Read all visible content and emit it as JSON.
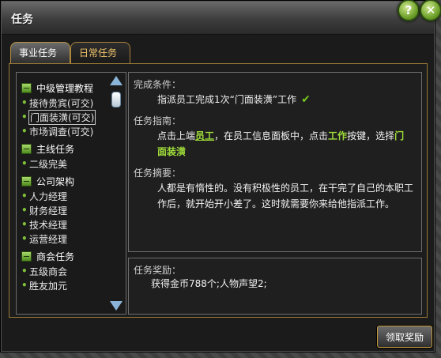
{
  "window": {
    "title": "任务",
    "help_label": "?",
    "close_label": "✕"
  },
  "tabs": [
    {
      "label": "事业任务",
      "active": true
    },
    {
      "label": "日常任务",
      "active": false
    }
  ],
  "task_list": {
    "groups": [
      {
        "label": "中级管理教程",
        "items": [
          "接待贵宾(可交)",
          "门面装潢(可交)",
          "市场调查(可交)"
        ]
      },
      {
        "label": "主线任务",
        "items": [
          "二级完美"
        ]
      },
      {
        "label": "公司架构",
        "items": [
          "人力经理",
          "财务经理",
          "技术经理",
          "运营经理"
        ]
      },
      {
        "label": "商会任务",
        "items": [
          "五级商会",
          "胜友加元"
        ]
      }
    ],
    "selected": "门面装潢(可交)"
  },
  "detail": {
    "condition_title": "完成条件：",
    "condition_text": "指派员工完成1次“门面装潢”工作",
    "guide_title": "任务指南：",
    "guide_text_1": "点击上端",
    "guide_kw_1": "员工",
    "guide_text_2": "，在员工信息面板中，点击",
    "guide_kw_2": "工作",
    "guide_text_3": "按键，选择",
    "guide_kw_3": "门面装潢",
    "summary_title": "任务摘要：",
    "summary_text": "人都是有惰性的。没有积极性的员工，在干完了自己的本职工作后，就开始开小差了。这时就需要你来给他指派工作。"
  },
  "reward": {
    "title": "任务奖励：",
    "text": "获得金币788个;人物声望2;"
  },
  "claim_button": "领取奖励",
  "colors": {
    "accent": "#9fdc3a",
    "border": "#9a7a36"
  }
}
